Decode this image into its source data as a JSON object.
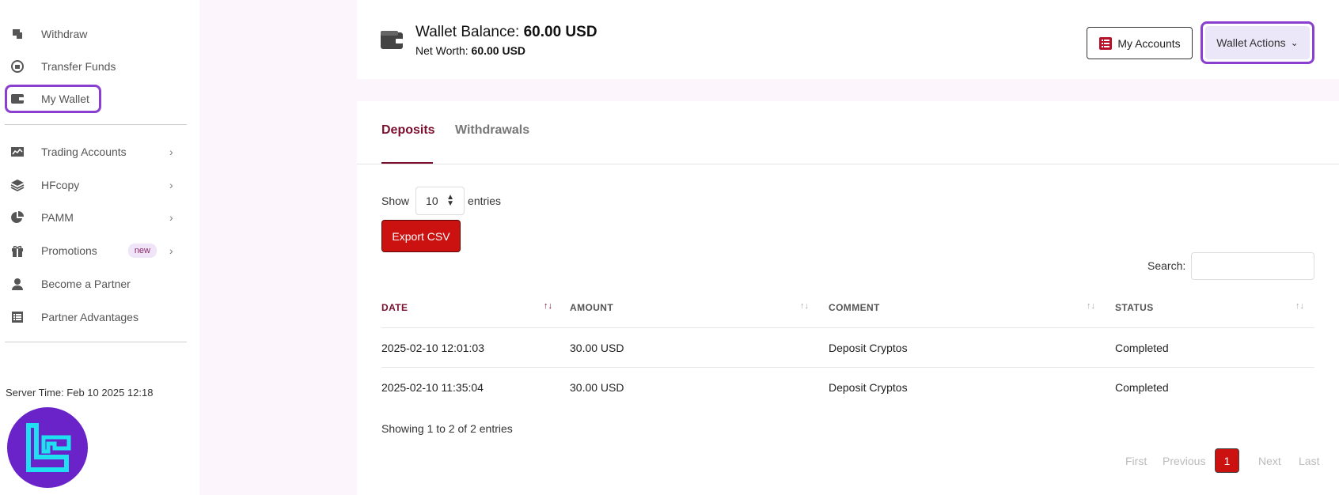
{
  "sidebar": {
    "items": [
      {
        "label": "Withdraw",
        "icon": "withdraw-icon"
      },
      {
        "label": "Transfer Funds",
        "icon": "transfer-icon"
      },
      {
        "label": "My Wallet",
        "icon": "wallet-icon"
      },
      {
        "label": "Trading Accounts",
        "icon": "chart-icon"
      },
      {
        "label": "HFcopy",
        "icon": "layers-icon"
      },
      {
        "label": "PAMM",
        "icon": "pie-icon"
      },
      {
        "label": "Promotions",
        "icon": "gift-icon",
        "badge": "new"
      },
      {
        "label": "Become a Partner",
        "icon": "user-icon"
      },
      {
        "label": "Partner Advantages",
        "icon": "list-icon"
      }
    ],
    "server_time": "Server Time: Feb 10 2025 12:18"
  },
  "header": {
    "balance_label": "Wallet Balance:",
    "balance_value": "60.00 USD",
    "net_worth_label": "Net Worth:",
    "net_worth_value": "60.00 USD",
    "my_accounts_label": "My Accounts",
    "wallet_actions_label": "Wallet Actions"
  },
  "tabs": {
    "deposits": "Deposits",
    "withdrawals": "Withdrawals"
  },
  "table_controls": {
    "show_label": "Show",
    "entries_value": "10",
    "entries_label": "entries",
    "export_label": "Export CSV",
    "search_label": "Search:"
  },
  "table": {
    "headers": [
      "DATE",
      "AMOUNT",
      "COMMENT",
      "STATUS"
    ],
    "rows": [
      {
        "date": "2025-02-10 12:01:03",
        "amount": "30.00 USD",
        "comment": "Deposit Cryptos",
        "status": "Completed"
      },
      {
        "date": "2025-02-10 11:35:04",
        "amount": "30.00 USD",
        "comment": "Deposit Cryptos",
        "status": "Completed"
      }
    ],
    "showing": "Showing 1 to 2 of 2 entries"
  },
  "pagination": {
    "first": "First",
    "previous": "Previous",
    "current": "1",
    "next": "Next",
    "last": "Last"
  },
  "colors": {
    "accent": "#7a0f2e",
    "button_red": "#cc1111",
    "highlight": "#8a3fd0"
  }
}
